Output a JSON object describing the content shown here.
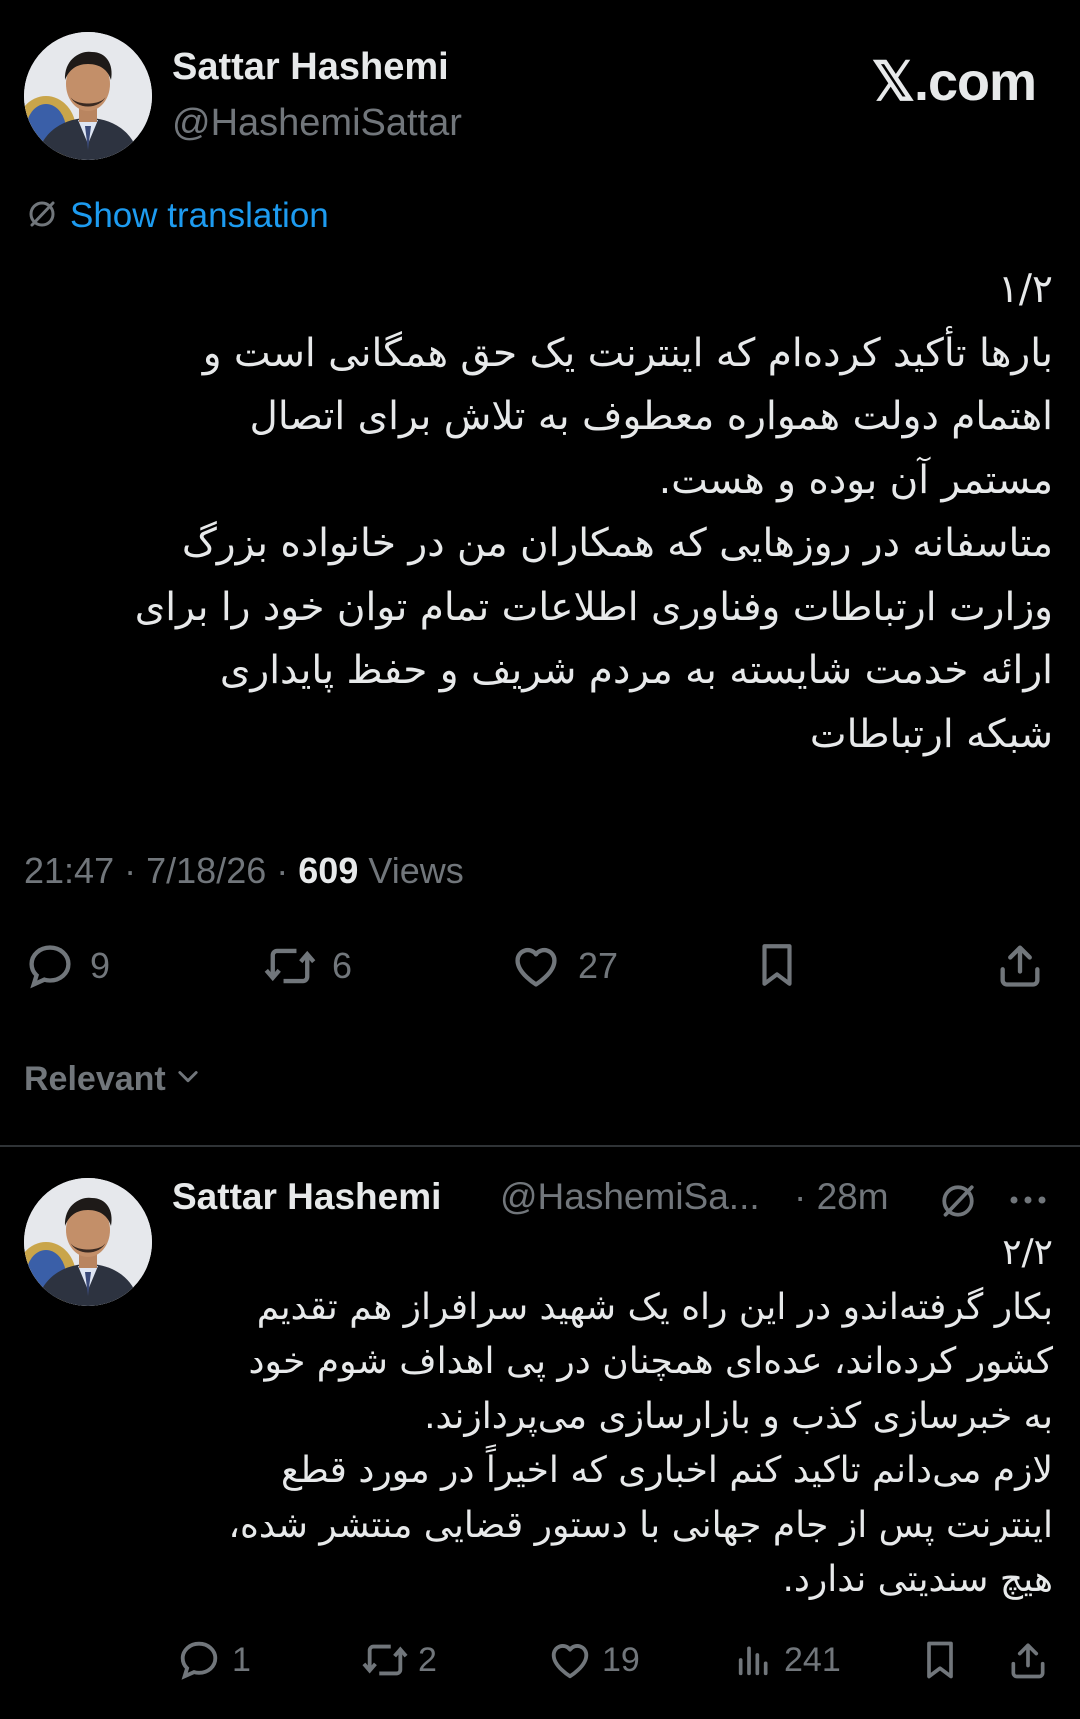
{
  "header": {
    "brand": "𝕏.com"
  },
  "main_tweet": {
    "author_name": "Sattar Hashemi",
    "author_handle": "@HashemiSattar",
    "show_translation": "Show translation",
    "lines": [
      "۱/۲",
      "بارها تأکید کرده‌ام که اینترنت یک حق همگانی است و",
      "اهتمام دولت همواره معطوف به تلاش برای اتصال",
      "مستمر آن بوده و هست.",
      "متاسفانه در روزهایی که همکاران من در خانواده بزرگ",
      "وزارت ارتباطات وفناوری اطلاعات تمام توان خود را برای",
      "ارائه خدمت شایسته به مردم شریف و حفظ پایداری",
      "شبکه ارتباطات"
    ],
    "time": "21:47",
    "date": "7/18/26",
    "views_count": "609",
    "views_label": "Views",
    "replies": "9",
    "reposts": "6",
    "likes": "27"
  },
  "sort": {
    "label": "Relevant"
  },
  "reply_tweet": {
    "author_name": "Sattar Hashemi",
    "author_handle": "@HashemiSa...",
    "time_ago": "· 28m",
    "lines": [
      "۲/۲",
      "بکار گرفته‌اندو در این راه یک شهید سرافراز هم تقدیم",
      "کشور کرده‌اند، عده‌ای همچنان در پی اهداف شوم خود",
      "به خبرسازی کذب و بازارسازی می‌پردازند.",
      "لازم می‌دانم تاکید کنم اخباری که اخیراً در مورد قطع",
      "اینترنت پس از جام جهانی با دستور قضایی منتشر شده،",
      "هیچ سندیتی ندارد."
    ],
    "replies": "1",
    "reposts": "2",
    "likes": "19",
    "views": "241"
  },
  "colors": {
    "background": "#000000",
    "text": "#e7e9ea",
    "muted": "#71767b",
    "link": "#1d9bf0",
    "divider": "#2f3336"
  },
  "icons": [
    "globe-icon",
    "reply-icon",
    "repost-icon",
    "like-icon",
    "bookmark-icon",
    "share-icon",
    "views-icon",
    "chevron-down-icon",
    "more-icon"
  ]
}
